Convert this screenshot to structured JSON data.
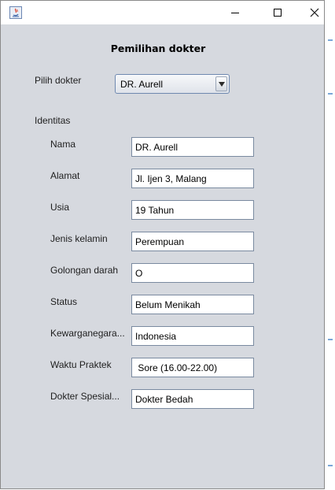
{
  "window": {
    "icon": "java-app-icon",
    "controls": {
      "minimize_icon": "minimize-icon",
      "maximize_icon": "maximize-icon",
      "close_icon": "close-icon"
    }
  },
  "form": {
    "heading": "Pemilihan dokter",
    "doctor_select": {
      "label": "Pilih dokter",
      "selected": "DR. Aurell",
      "arrow_icon": "dropdown-arrow-icon"
    },
    "section_label": "Identitas",
    "fields": [
      {
        "label": "Nama",
        "value": "DR. Aurell"
      },
      {
        "label": "Alamat",
        "value": "Jl. Ijen 3, Malang"
      },
      {
        "label": "Usia",
        "value": "19 Tahun"
      },
      {
        "label": "Jenis kelamin",
        "value": "Perempuan"
      },
      {
        "label": "Golongan darah",
        "value": "O"
      },
      {
        "label": "Status",
        "value": "Belum Menikah"
      },
      {
        "label": "Kewarganegara...",
        "value": "Indonesia"
      },
      {
        "label": "Waktu Praktek",
        "value": " Sore (16.00-22.00)"
      },
      {
        "label": "Dokter Spesial...",
        "value": "Dokter Bedah"
      }
    ]
  },
  "colors": {
    "window_background": "#d6d9df",
    "titlebar": "#ffffff",
    "field_border": "#7a8aa0"
  }
}
